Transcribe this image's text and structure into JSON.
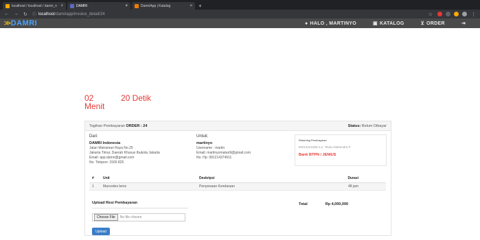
{
  "browser": {
    "tabs": [
      {
        "label": "localhost / localhost / damri_n",
        "color": "#f9ab00"
      },
      {
        "label": "DAMRI",
        "color": "#5c6bc0"
      },
      {
        "label": "DamriApp | Katalog",
        "color": "#f57c00"
      }
    ],
    "new_tab": "+",
    "url_host": "localhost",
    "url_path": "/damriapp/invoice_detail/24"
  },
  "nav": {
    "logo": "DAMRI",
    "greeting": "HALO , MARTINYO",
    "katalog": "KATALOG",
    "order": "ORDER"
  },
  "countdown": {
    "minutes": "02 Menit",
    "seconds": "20 Detik"
  },
  "invoice": {
    "header_label": "Tagihan Pembayaran",
    "order_label": "ORDER : 24",
    "status_label": "Status:",
    "status_value": "Belum Dibayar",
    "from": {
      "label": "Dari:",
      "name": "DAMRI Indonesia",
      "lines": [
        "Jalan Matraman Raya No.25",
        "Jakarta Timur, Daerah Khusus Ibukota Jakarta",
        "Email: app.damri@gmail.com",
        "No. Telepon: 1500 825"
      ]
    },
    "to": {
      "label": "Untuk:",
      "name": "martinyo",
      "lines": [
        "Username : martin",
        "Email: martinyomatan9@gmail.com",
        "No. Hp: 081214374511"
      ]
    },
    "bank": {
      "title": "Rekening Pembayaran",
      "account": "9001422159Z a.n. Teuku Mahendra P",
      "name": "Bank BTPN / JENIUS"
    },
    "table": {
      "headers": [
        "#",
        "Unit",
        "Deskripsi",
        "Durasi"
      ],
      "rows": [
        [
          "1",
          "Marcedes benz",
          "Penyewaan Kendaraan",
          "48 jam"
        ]
      ]
    },
    "upload": {
      "title": "Upload Resi Pembayaran",
      "choose": "Choose File",
      "no_file": "No file chosen",
      "button": "Upload"
    },
    "total": {
      "label": "Total",
      "value": "Rp 4,000,000"
    }
  }
}
